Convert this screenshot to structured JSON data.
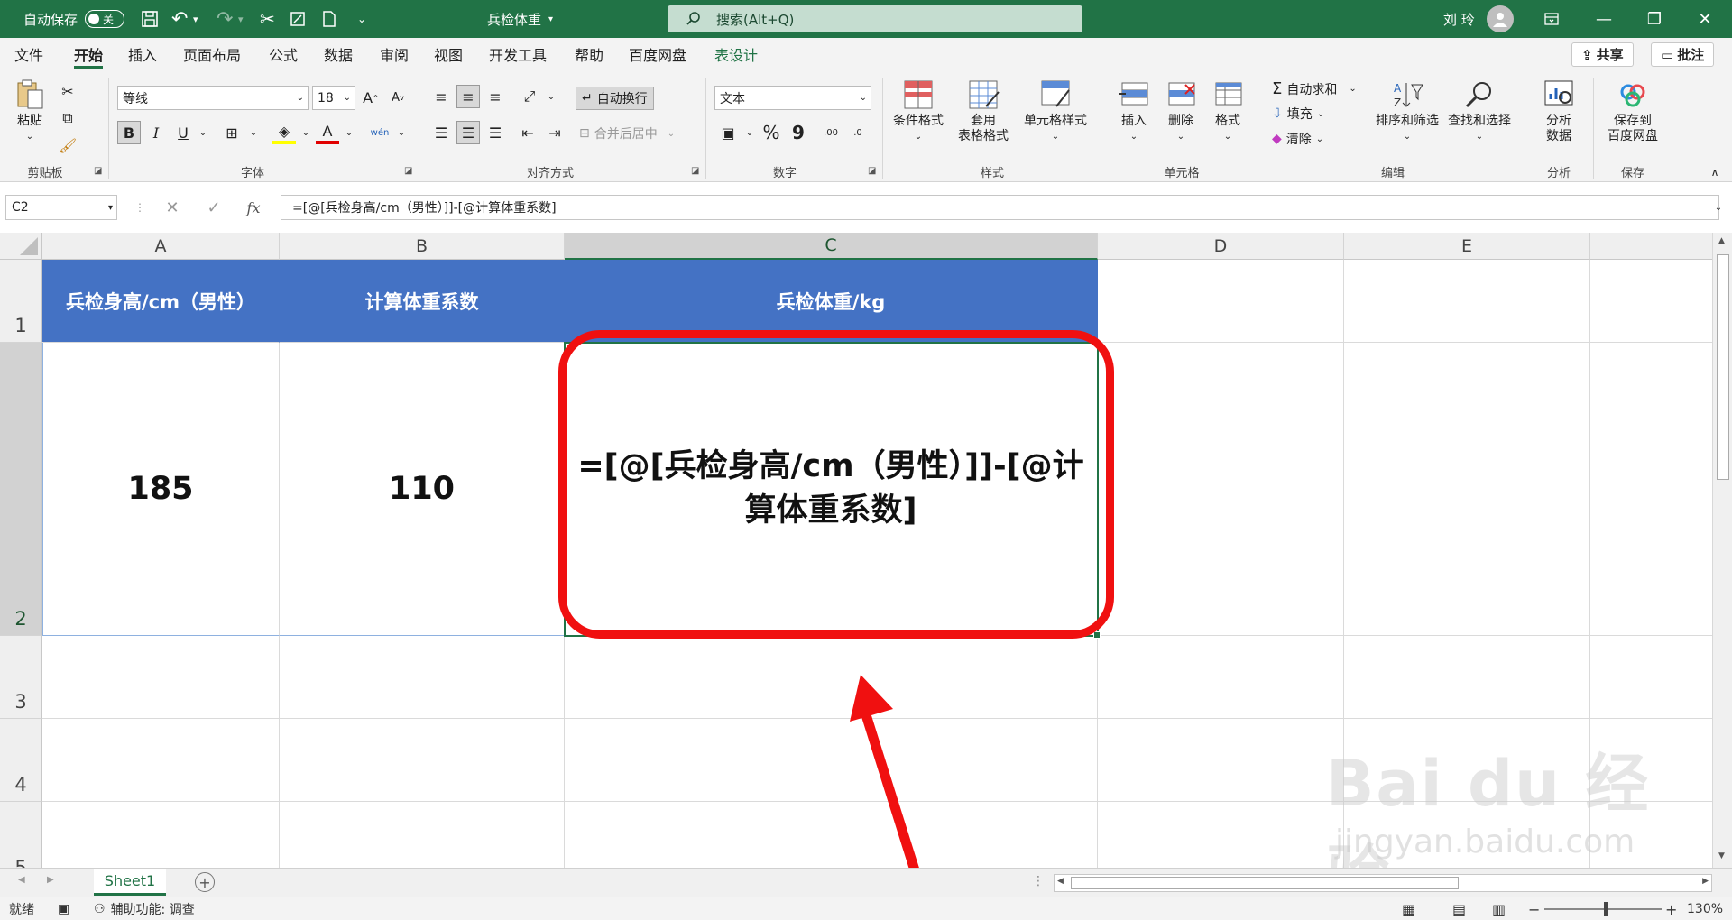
{
  "titlebar": {
    "autosave_label": "自动保存",
    "autosave_state": "关",
    "doc_title": "兵检体重",
    "search_placeholder": "搜索(Alt+Q)",
    "user_name": "刘 玲"
  },
  "tabs": [
    "文件",
    "开始",
    "插入",
    "页面布局",
    "公式",
    "数据",
    "审阅",
    "视图",
    "开发工具",
    "帮助",
    "百度网盘",
    "表设计"
  ],
  "active_tab": "开始",
  "share_label": "共享",
  "comment_label": "批注",
  "ribbon": {
    "clipboard": {
      "paste": "粘贴",
      "group": "剪贴板"
    },
    "font": {
      "name": "等线",
      "size": "18",
      "group": "字体",
      "bold": "B",
      "italic": "I",
      "underline": "U"
    },
    "alignment": {
      "wrap": "自动换行",
      "merge": "合并后居中",
      "group": "对齐方式"
    },
    "number": {
      "format": "文本",
      "group": "数字"
    },
    "styles": {
      "cond": "条件格式",
      "table_fmt_1": "套用",
      "table_fmt_2": "表格格式",
      "cell_style": "单元格样式",
      "group": "样式"
    },
    "cells": {
      "insert": "插入",
      "delete": "删除",
      "format": "格式",
      "group": "单元格"
    },
    "editing": {
      "autosum": "自动求和",
      "fill": "填充",
      "clear": "清除",
      "sort": "排序和筛选",
      "find": "查找和选择",
      "group": "编辑"
    },
    "analysis": {
      "btn_1": "分析",
      "btn_2": "数据",
      "group": "分析"
    },
    "save": {
      "btn_1": "保存到",
      "btn_2": "百度网盘",
      "group": "保存"
    }
  },
  "formula_bar": {
    "name_box": "C2",
    "fx": "fx",
    "formula": "=[@[兵检身高/cm（男性）]]-[@计算体重系数]"
  },
  "sheet": {
    "columns": [
      "A",
      "B",
      "C",
      "D",
      "E"
    ],
    "rows": [
      "1",
      "2",
      "3",
      "4",
      "5"
    ],
    "headers": [
      "兵检身高/cm（男性）",
      "计算体重系数",
      "兵检体重/kg"
    ],
    "row2": [
      "185",
      "110",
      "=[@[兵检身高/cm（男性）]]-[@计算体重系数]"
    ]
  },
  "watermark": {
    "brand": "Bai du 经验",
    "url": "jingyan.baidu.com"
  },
  "sheet_tabs": [
    "Sheet1"
  ],
  "status": {
    "ready": "就绪",
    "accessibility": "辅助功能: 调查",
    "zoom": "130%"
  },
  "colors": {
    "excel_green": "#217346",
    "header_fill": "#4472c4",
    "callout_red": "#f01010"
  }
}
